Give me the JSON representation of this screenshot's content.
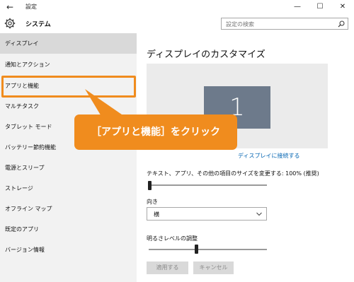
{
  "window": {
    "back_glyph": "←",
    "title": "設定",
    "controls": {
      "minimize": "—",
      "maximize": "☐",
      "close": "✕"
    }
  },
  "header": {
    "icon": "gear-icon",
    "title": "システム",
    "search_placeholder": "設定の検索"
  },
  "sidebar": {
    "items": [
      {
        "label": "ディスプレイ",
        "active": true
      },
      {
        "label": "通知とアクション"
      },
      {
        "label": "アプリと機能"
      },
      {
        "label": "マルチタスク"
      },
      {
        "label": "タブレット モード"
      },
      {
        "label": "バッテリー節約機能"
      },
      {
        "label": "電源とスリープ"
      },
      {
        "label": "ストレージ"
      },
      {
        "label": "オフライン マップ"
      },
      {
        "label": "既定のアプリ"
      },
      {
        "label": "バージョン情報"
      }
    ]
  },
  "callout": {
    "text": "［アプリと機能］をクリック"
  },
  "main": {
    "title": "ディスプレイのカスタマイズ",
    "monitor_number": "1",
    "connect_link": "ディスプレイに接続する",
    "size_label": "テキスト、アプリ、その他の項目のサイズを変更する: 100% (推奨)",
    "size_slider_value": 0,
    "orientation_label": "向き",
    "orientation_value": "横",
    "brightness_label": "明るさレベルの調整",
    "brightness_slider_value": 0.39,
    "apply_button": "適用する",
    "cancel_button": "キャンセル"
  },
  "colors": {
    "accent_orange": "#f08c1e",
    "monitor": "#6d7a8b",
    "link": "#0063b1",
    "sidebar_bg": "#f2f2f2",
    "selected_bg": "#d9d9d9"
  }
}
